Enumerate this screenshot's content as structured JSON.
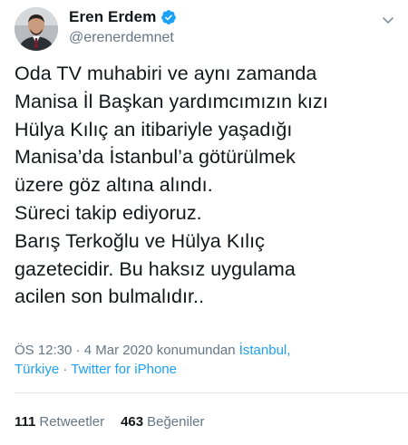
{
  "author": {
    "display_name": "Eren Erdem",
    "handle": "@erenerdemnet",
    "verified": true
  },
  "tweet": {
    "text": "Oda TV muhabiri ve aynı zamanda\nManisa İl Başkan yardımcımızın kızı\nHülya Kılıç an itibariyle yaşadığı\nManisa’da İstanbul’a götürülmek\nüzere göz altına alındı.\nSüreci takip ediyoruz.\nBarış Terkoğlu ve Hülya Kılıç\ngazetecidir. Bu haksız uygulama\nacilen son bulmalıdır.."
  },
  "meta": {
    "time": "ÖS 12:30",
    "separator": " · ",
    "date": "4 Mar 2020",
    "location_prefix": "konumundan",
    "location_line1": "İstanbul,",
    "location_line2": "Türkiye",
    "source": "Twitter for iPhone"
  },
  "stats": {
    "retweets_count": "111",
    "retweets_label": "Retweetler",
    "likes_count": "463",
    "likes_label": "Beğeniler"
  },
  "colors": {
    "accent": "#1da1f2",
    "secondary_text": "#657786",
    "divider": "#e1e8ed"
  },
  "icons": {
    "verified": "verified-badge-icon",
    "menu": "chevron-down-icon",
    "avatar": "profile-photo"
  }
}
